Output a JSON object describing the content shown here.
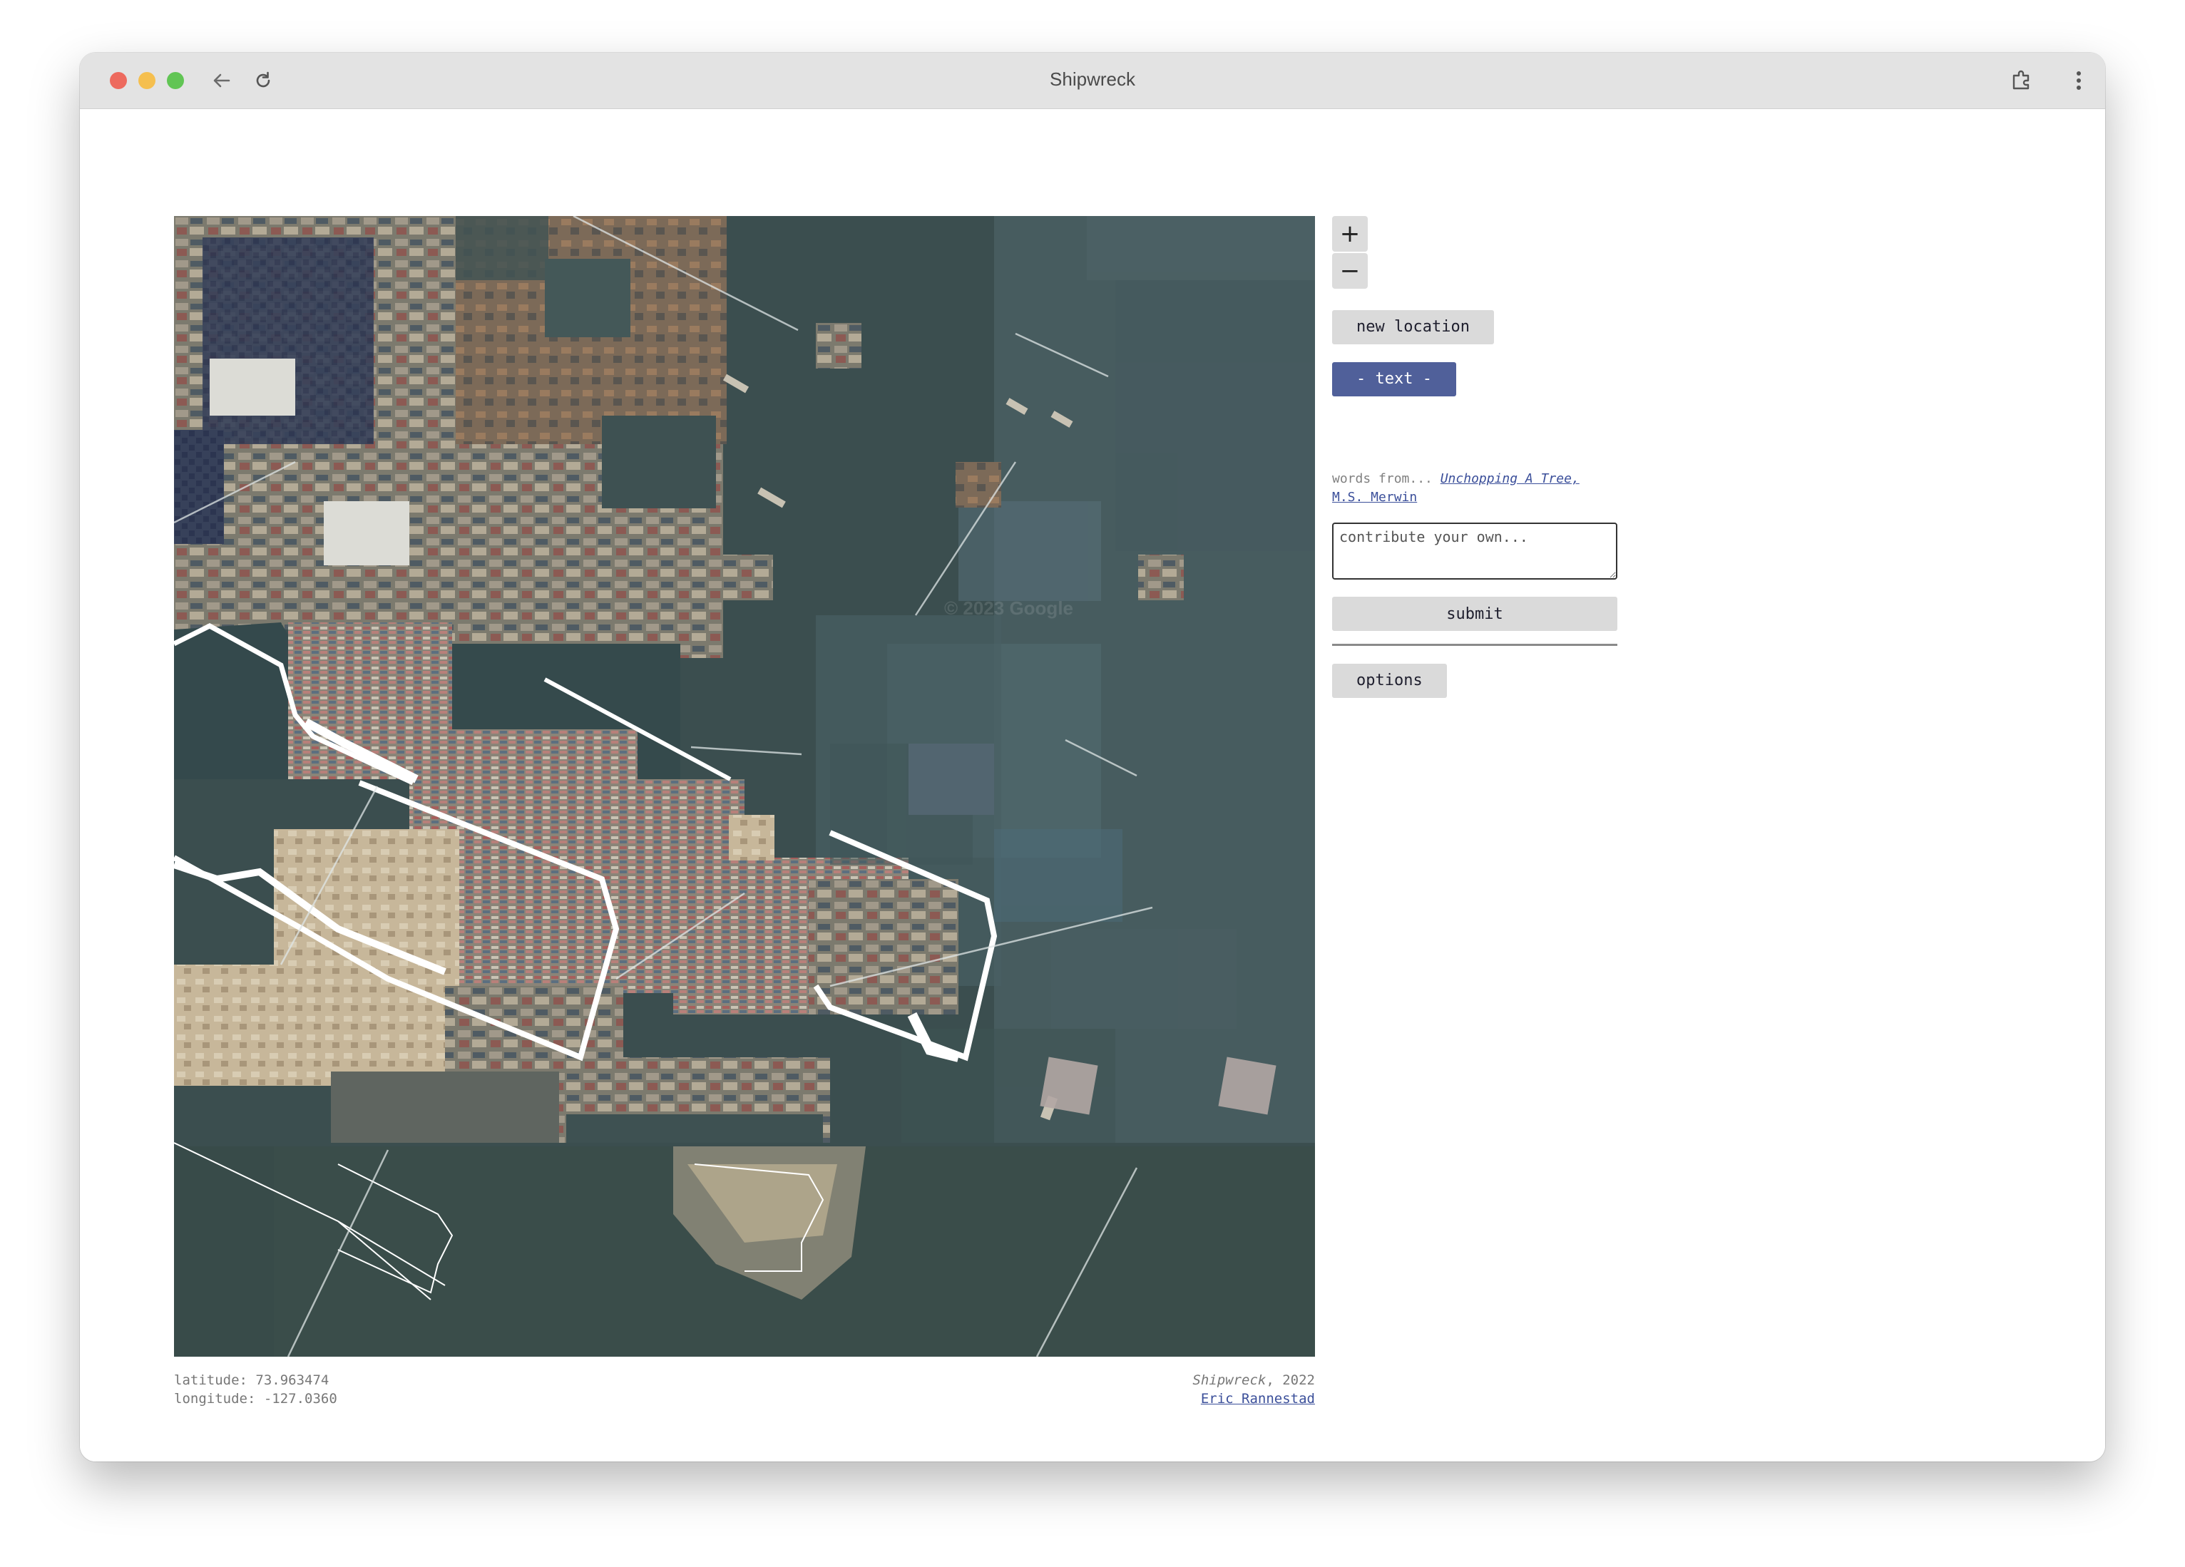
{
  "window": {
    "title": "Shipwreck"
  },
  "controls": {
    "zoom_in": "+",
    "zoom_out": "−",
    "new_location": "new location",
    "text_toggle": "- text -",
    "words_from": "words from... ",
    "poem_title": "Unchopping A Tree,",
    "poem_author": "M.S. Merwin",
    "contribute_placeholder": "contribute your own...",
    "submit": "submit",
    "options": "options"
  },
  "map": {
    "watermark": "© 2023 Google",
    "watermark_small": "© 2023 Google"
  },
  "coords": {
    "latitude": "latitude: 73.963474",
    "longitude": "longitude: -127.0360"
  },
  "attribution": {
    "title": "Shipwreck",
    "year": ", 2022",
    "author": "Eric Rannestad"
  },
  "colors": {
    "water": "#3b4e4f",
    "accent_button": "#50609a",
    "link": "#3b4f9a"
  },
  "icons": [
    "back-arrow-icon",
    "reload-icon",
    "extension-icon",
    "more-vert-icon"
  ]
}
